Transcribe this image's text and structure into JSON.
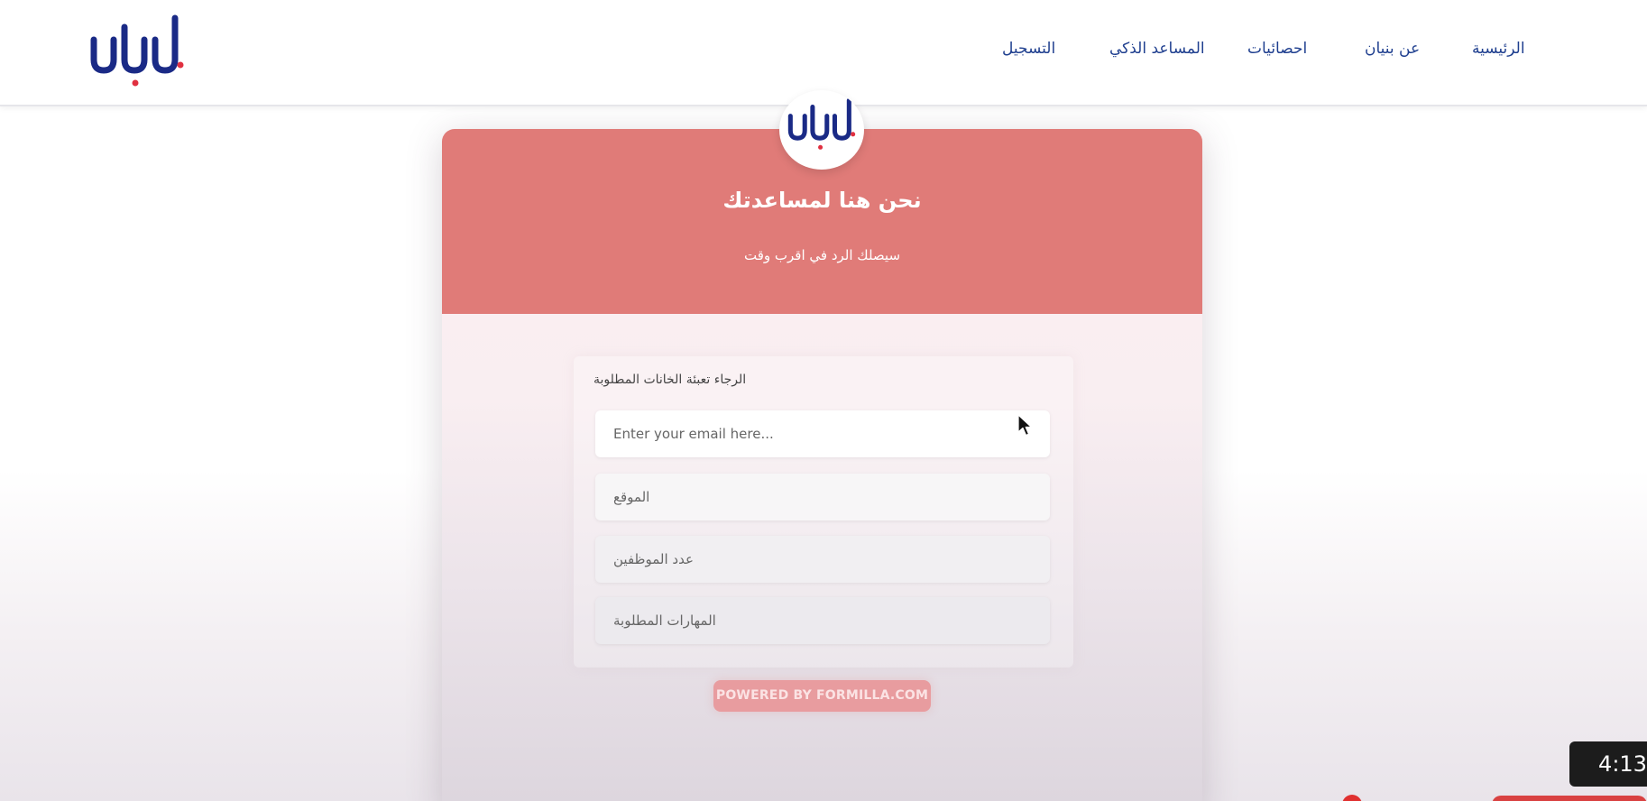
{
  "header": {
    "logo_icon": "bunyan-logo-icon",
    "nav": [
      {
        "label": "الرئيسية"
      },
      {
        "label": "عن بنيان"
      },
      {
        "label": "احصائيات"
      },
      {
        "label": "المساعد الذكي"
      },
      {
        "label": "التسجيل"
      }
    ]
  },
  "card": {
    "avatar_icon": "bunyan-logo-icon",
    "title": "نحن هنا لمساعدتك",
    "subtitle": "سيصلك الرد في اقرب وقت",
    "header_color": "#e07b78"
  },
  "form": {
    "label": "الرجاء تعبئة الخانات المطلوبة",
    "email": {
      "value": "",
      "placeholder": "Enter your email here..."
    },
    "location": {
      "value": "",
      "placeholder": "الموقع"
    },
    "employees": {
      "value": "",
      "placeholder": "عدد الموظفين"
    },
    "skills": {
      "value": "",
      "placeholder": "المهارات المطلوبة"
    },
    "powered_by": "POWERED BY FORMILLA.COM"
  },
  "video": {
    "duration": "4:13",
    "cursor_icon": "mouse-pointer-icon"
  },
  "colors": {
    "brand_navy": "#1a2a86",
    "brand_accent_red": "#e03040",
    "nav_text": "#1f3f8f",
    "button": "#e89c9f"
  }
}
